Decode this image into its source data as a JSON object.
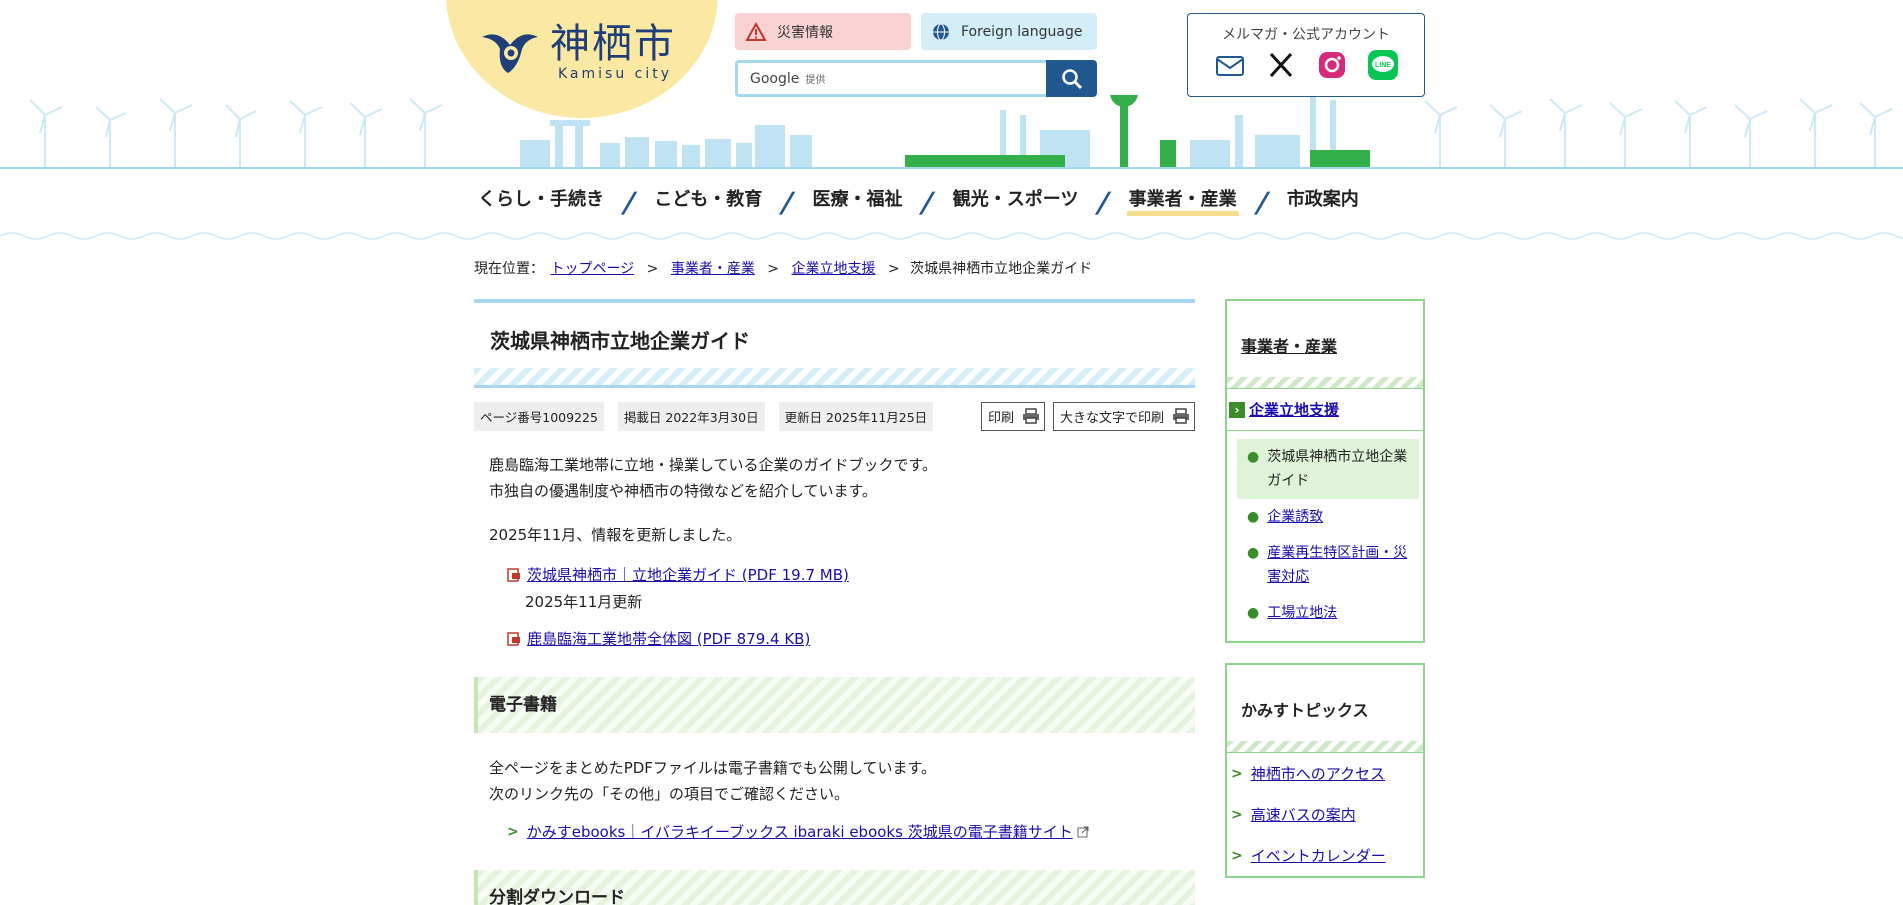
{
  "header": {
    "logo_jp": "神栖市",
    "logo_en": "Kamisu city",
    "disaster_label": "災害情報",
    "lang_label": "Foreign language",
    "search_placeholder": "Google",
    "search_sub": "提供",
    "accounts_title": "メルマガ・公式アカウント"
  },
  "gnav": {
    "items": [
      {
        "label": "くらし・手続き"
      },
      {
        "label": "こども・教育"
      },
      {
        "label": "医療・福祉"
      },
      {
        "label": "観光・スポーツ"
      },
      {
        "label": "事業者・産業"
      },
      {
        "label": "市政案内"
      }
    ],
    "sep": "/"
  },
  "breadcrumb": {
    "prefix": "現在位置：",
    "links": [
      "トップページ",
      "事業者・産業",
      "企業立地支援"
    ],
    "current": "茨城県神栖市立地企業ガイド",
    "sep": ">"
  },
  "page": {
    "title": "茨城県神栖市立地企業ガイド",
    "page_number": "ページ番号1009225",
    "published": "掲載日 2022年3月30日",
    "updated": "更新日 2025年11月25日",
    "print_label": "印刷",
    "print_large_label": "大きな文字で印刷",
    "intro_line1": "鹿島臨海工業地帯に立地・操業している企業のガイドブックです。",
    "intro_line2": "市独自の優遇制度や神栖市の特徴などを紹介しています。",
    "update_note": "2025年11月、情報を更新しました。",
    "file1_label": "茨城県神栖市｜立地企業ガイド (PDF 19.7 MB)",
    "file1_note": "2025年11月更新",
    "file2_label": "鹿島臨海工業地帯全体図 (PDF 879.4 KB)",
    "section1_title": "電子書籍",
    "section1_line1": "全ページをまとめたPDFファイルは電子書籍でも公開しています。",
    "section1_line2": "次のリンク先の「その他」の項目でご確認ください。",
    "ebook_link": "かみすebooks｜イバラキイーブックス ibaraki ebooks 茨城県の電子書籍サイト",
    "section2_title": "分割ダウンロード"
  },
  "side": {
    "box1_title": "事業者・産業",
    "parent": "企業立地支援",
    "children": [
      {
        "label": "茨城県神栖市立地企業ガイド"
      },
      {
        "label": "企業誘致"
      },
      {
        "label": "産業再生特区計画・災害対応"
      },
      {
        "label": "工場立地法"
      }
    ],
    "box2_title": "かみすトピックス",
    "topics": [
      {
        "label": "神栖市へのアクセス"
      },
      {
        "label": "高速バスの案内"
      },
      {
        "label": "イベントカレンダー"
      }
    ]
  },
  "colors": {
    "navy": "#20588f",
    "light_blue": "#a5d8ee",
    "green": "#3a8d2a",
    "yellow": "#fbe9a3"
  }
}
